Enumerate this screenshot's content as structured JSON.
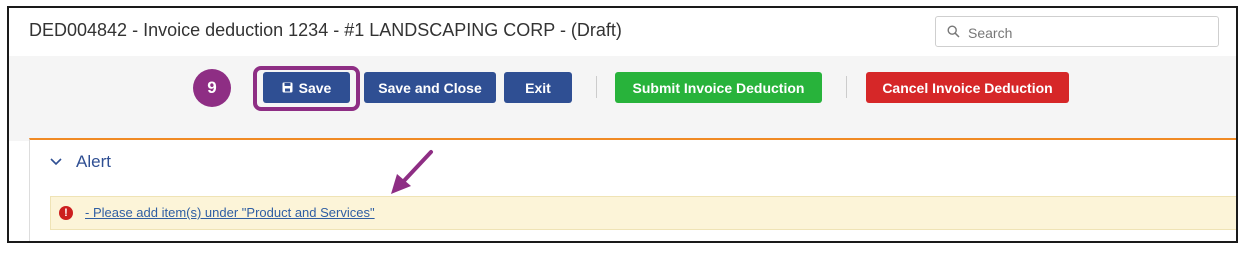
{
  "header": {
    "title": "DED004842 - Invoice deduction 1234 - #1 LANDSCAPING CORP - (Draft)",
    "search": {
      "placeholder": "Search",
      "value": ""
    }
  },
  "toolbar": {
    "step_number": "9",
    "save_label": "Save",
    "save_close_label": "Save and Close",
    "exit_label": "Exit",
    "submit_label": "Submit Invoice Deduction",
    "cancel_label": "Cancel Invoice Deduction"
  },
  "alert": {
    "section_title": "Alert",
    "message": "- Please add item(s) under \"Product and Services\""
  },
  "icons": {
    "search": "search-icon",
    "save": "floppy-disk-icon",
    "collapse": "chevron-down-icon",
    "error": "exclamation-circle-icon",
    "annotation": "arrow-pointer-icon"
  },
  "colors": {
    "primary": "#2f4f93",
    "success": "#28b33b",
    "danger": "#d62728",
    "highlight": "#8e2e84",
    "panel_accent": "#f08a24",
    "alert_bg": "#fcf4d8"
  }
}
